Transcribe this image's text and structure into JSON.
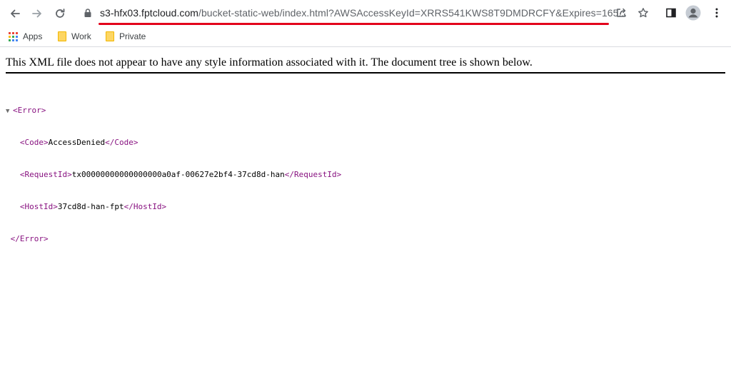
{
  "browser": {
    "url_host": "s3-hfx03.fptcloud.com",
    "url_rest": "/bucket-static-web/index.html?AWSAccessKeyId=XRRS541KWS8T9DMDRCFY&Expires=165..."
  },
  "bookmarks": [
    {
      "label": "Apps",
      "icon": "apps-grid-icon"
    },
    {
      "label": "Work",
      "icon": "folder-icon"
    },
    {
      "label": "Private",
      "icon": "folder-icon"
    }
  ],
  "page": {
    "xml_info": "This XML file does not appear to have any style information associated with it. The document tree is shown below.",
    "tree": {
      "root_open": "<Error>",
      "root_close": "</Error>",
      "code": {
        "open": "<Code>",
        "value": "AccessDenied",
        "close": "</Code>"
      },
      "request_id": {
        "open": "<RequestId>",
        "value": "tx00000000000000000a0af-00627e2bf4-37cd8d-han",
        "close": "</RequestId>"
      },
      "host_id": {
        "open": "<HostId>",
        "value": "37cd8d-han-fpt",
        "close": "</HostId>"
      }
    }
  },
  "colors": {
    "underline_accent": "#e3001b",
    "xml_tag": "#881280",
    "folder": "#fdd663"
  }
}
